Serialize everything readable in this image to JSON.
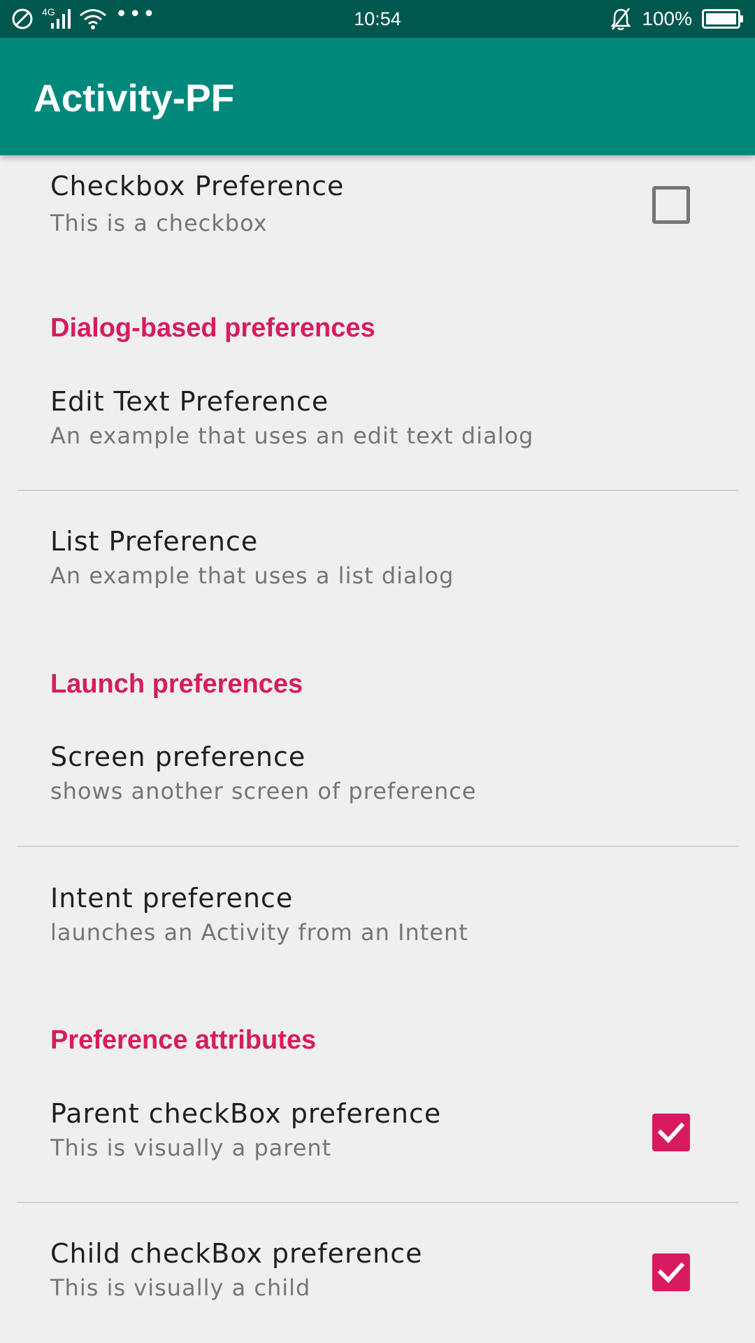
{
  "status_bar": {
    "time": "10:54",
    "battery": "100%",
    "network": "4G",
    "icons": [
      "no-disturb-icon",
      "signal-icon",
      "wifi-icon",
      "more-dots-icon",
      "notification-off-icon",
      "battery-icon"
    ]
  },
  "app_bar": {
    "title": "Activity-PF"
  },
  "prefs": {
    "checkbox": {
      "title": "Checkbox Preference",
      "summary": "This is a checkbox",
      "checked": false
    },
    "cat_dialog": "Dialog-based preferences",
    "edit_text": {
      "title": "Edit Text Preference",
      "summary": "An example that uses an edit text dialog"
    },
    "list": {
      "title": "List Preference",
      "summary": "An example that uses a list dialog"
    },
    "cat_launch": "Launch preferences",
    "screen": {
      "title": "Screen preference",
      "summary": "shows another screen of preference"
    },
    "intent": {
      "title": "Intent preference",
      "summary": "launches an Activity from an Intent"
    },
    "cat_attributes": "Preference attributes",
    "parent": {
      "title": "Parent checkBox preference",
      "summary": "This is visually a parent",
      "checked": true
    },
    "child": {
      "title": "Child checkBox preference",
      "summary": "This is visually a child",
      "checked": true
    }
  },
  "colors": {
    "status_bar": "#00574d",
    "app_bar": "#00897b",
    "accent": "#d81b60",
    "background": "#efefef"
  }
}
